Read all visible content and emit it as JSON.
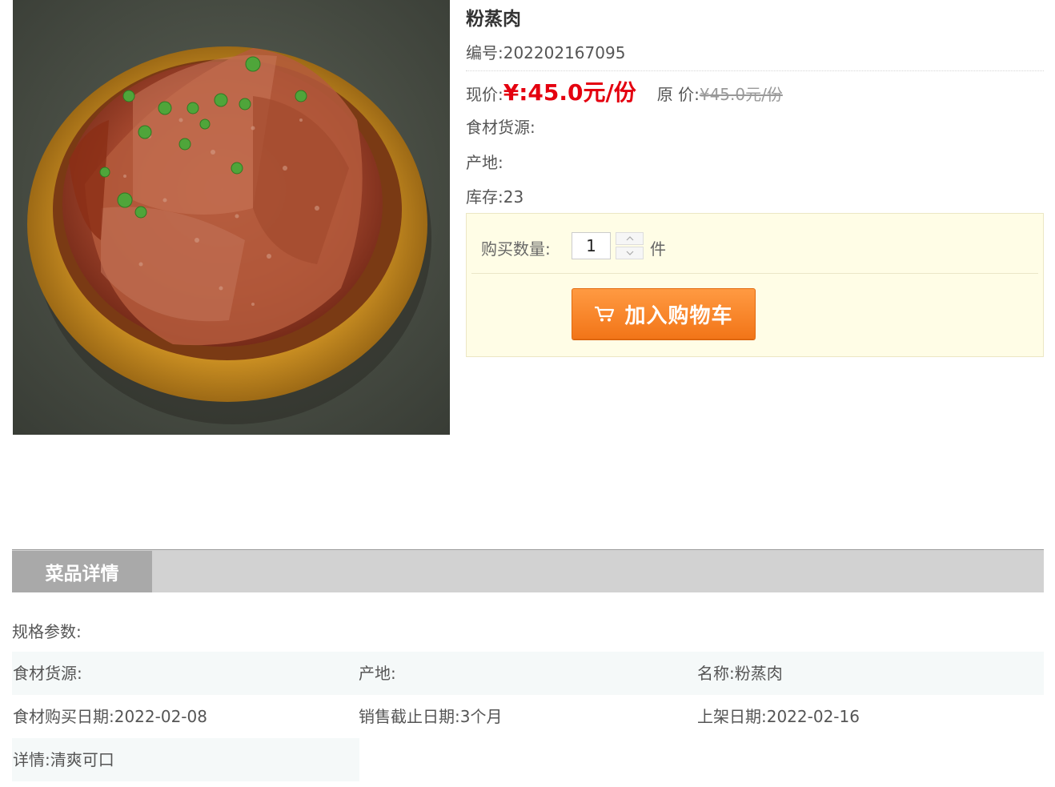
{
  "product": {
    "name": "粉蒸肉",
    "code": "编号:202202167095",
    "price_label": "现价:",
    "price_now": "¥:45.0元/份",
    "orig_label": "原 价:",
    "orig_price": "¥45.0元/份",
    "source": "食材货源:",
    "origin": "产地:",
    "stock": "库存:23"
  },
  "purchase": {
    "qty_label": "购买数量:",
    "qty_value": "1",
    "unit": "件",
    "cart_button": "加入购物车"
  },
  "details": {
    "tab": "菜品详情",
    "spec_label": "规格参数:",
    "rows": [
      [
        "食材货源:",
        "产地:",
        "名称:粉蒸肉"
      ],
      [
        "食材购买日期:2022-02-08",
        "销售截止日期:3个月",
        "上架日期:2022-02-16"
      ],
      [
        "详情:清爽可口"
      ]
    ]
  },
  "icons": {
    "cart": "shopping-cart-icon",
    "spin_up": "chevron-up-icon",
    "spin_down": "chevron-down-icon"
  },
  "colors": {
    "price": "#e4000f",
    "button": "#f27518",
    "buy_box": "#fffde6",
    "tab_active": "#a9a9a9",
    "tab_bar": "#d2d2d2"
  }
}
